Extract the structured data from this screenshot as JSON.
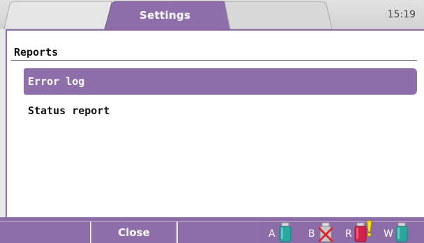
{
  "header": {
    "tab_title": "Settings",
    "clock": "15:19"
  },
  "main": {
    "section_title": "Reports",
    "items": [
      {
        "label": "Error log",
        "selected": true
      },
      {
        "label": "Status report",
        "selected": false
      }
    ]
  },
  "footer": {
    "softkeys": [
      "",
      "Close",
      ""
    ],
    "reagents": [
      {
        "letter": "A",
        "status": "ok",
        "color": "#2aa8a0"
      },
      {
        "letter": "B",
        "status": "missing",
        "color": "#c7c7c7"
      },
      {
        "letter": "R",
        "status": "warning",
        "color": "#d3234a"
      },
      {
        "letter": "W",
        "status": "ok",
        "color": "#2aa8a0"
      }
    ]
  },
  "colors": {
    "accent": "#8f6fa9",
    "selection_text": "#ffffff",
    "background": "#e8e8e8"
  }
}
